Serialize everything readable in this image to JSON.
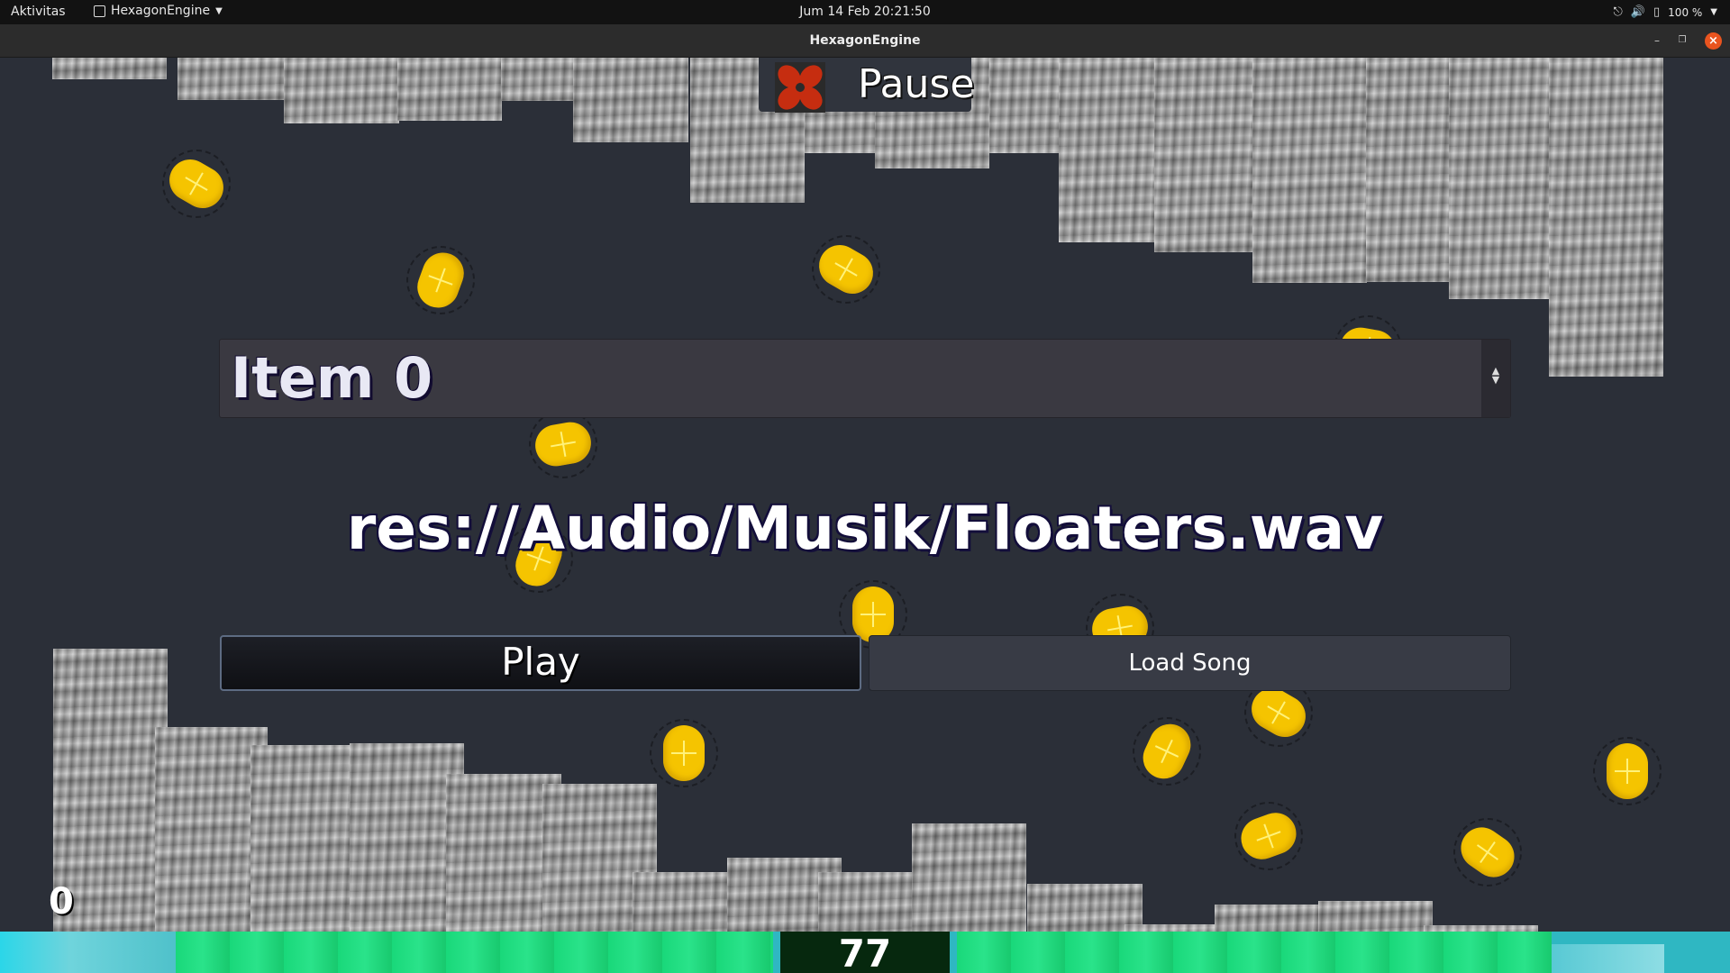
{
  "topbar": {
    "activities": "Aktivitas",
    "app_menu": "HexagonEngine",
    "clock": "Jum 14 Feb  20:21:50",
    "battery": "100 %"
  },
  "window": {
    "title": "HexagonEngine"
  },
  "game": {
    "pause_label": "Pause",
    "item_select_value": "Item 0",
    "song_path": "res://Audio/Musik/Floaters.wav",
    "play_label": "Play",
    "load_label": "Load Song",
    "counter": "0",
    "score": "77"
  },
  "icons": {
    "network": "network-icon",
    "volume": "volume-icon",
    "battery": "battery-icon",
    "pause": "pause-flower-icon"
  },
  "colors": {
    "background": "#2b2f38",
    "coin": "#f5c400",
    "bar_green": "#19d87a",
    "bar_cyan": "#2fb7c2",
    "close_button": "#e9541f"
  }
}
